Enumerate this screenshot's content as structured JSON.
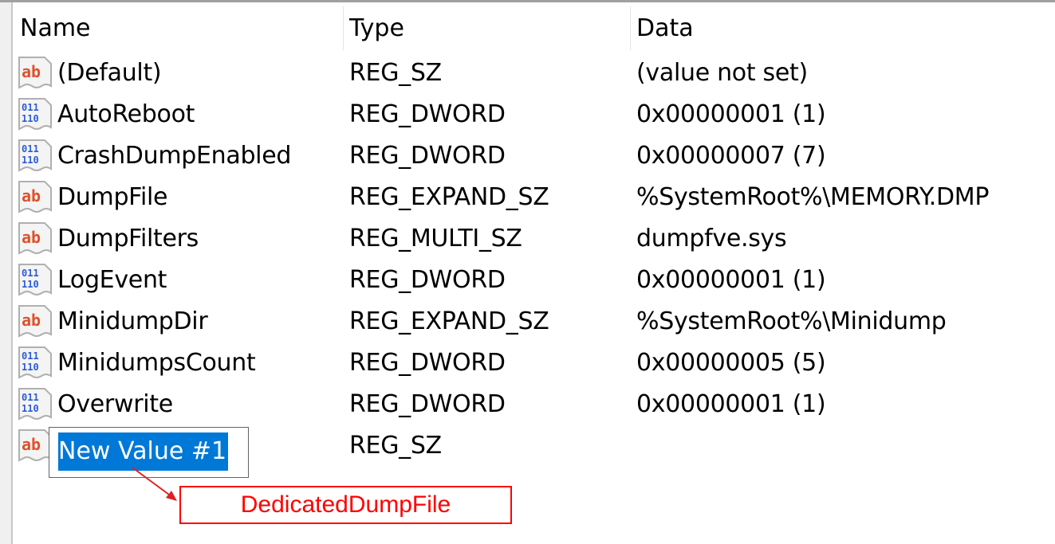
{
  "columns": {
    "name": "Name",
    "type": "Type",
    "data": "Data"
  },
  "rows": [
    {
      "icon": "string-value-icon",
      "name": "(Default)",
      "type": "REG_SZ",
      "data": "(value not set)"
    },
    {
      "icon": "binary-value-icon",
      "name": "AutoReboot",
      "type": "REG_DWORD",
      "data": "0x00000001 (1)"
    },
    {
      "icon": "binary-value-icon",
      "name": "CrashDumpEnabled",
      "type": "REG_DWORD",
      "data": "0x00000007 (7)"
    },
    {
      "icon": "string-value-icon",
      "name": "DumpFile",
      "type": "REG_EXPAND_SZ",
      "data": "%SystemRoot%\\MEMORY.DMP"
    },
    {
      "icon": "string-value-icon",
      "name": "DumpFilters",
      "type": "REG_MULTI_SZ",
      "data": "dumpfve.sys"
    },
    {
      "icon": "binary-value-icon",
      "name": "LogEvent",
      "type": "REG_DWORD",
      "data": "0x00000001 (1)"
    },
    {
      "icon": "string-value-icon",
      "name": "MinidumpDir",
      "type": "REG_EXPAND_SZ",
      "data": "%SystemRoot%\\Minidump"
    },
    {
      "icon": "binary-value-icon",
      "name": "MinidumpsCount",
      "type": "REG_DWORD",
      "data": "0x00000005 (5)"
    },
    {
      "icon": "binary-value-icon",
      "name": "Overwrite",
      "type": "REG_DWORD",
      "data": "0x00000001 (1)"
    }
  ],
  "new_row": {
    "icon": "string-value-icon",
    "name_edit_value": "New Value #1",
    "type": "REG_SZ",
    "data": ""
  },
  "annotation": {
    "text": "DedicatedDumpFile",
    "color": "#ff0000"
  },
  "colors": {
    "selection": "#0078d7",
    "string_icon": "#e0502a",
    "binary_icon": "#2a5bd7"
  }
}
